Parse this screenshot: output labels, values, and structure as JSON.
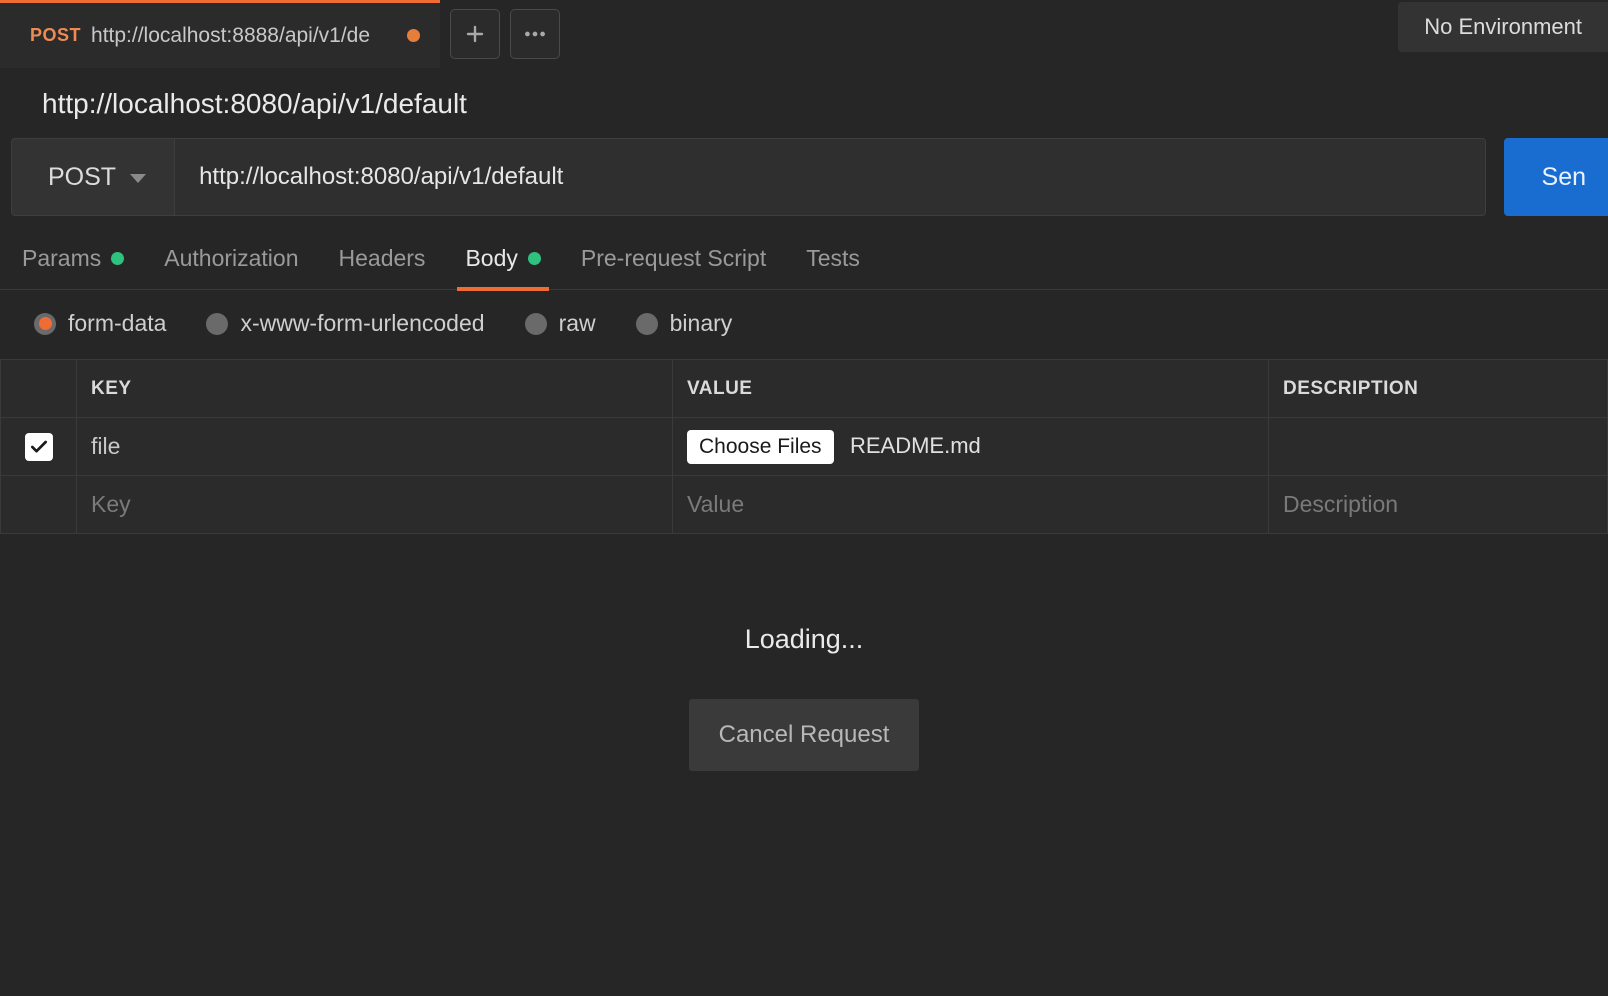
{
  "tab": {
    "method": "POST",
    "url": "http://localhost:8888/api/v1/de"
  },
  "environment": {
    "label": "No Environment"
  },
  "title": "http://localhost:8080/api/v1/default",
  "request": {
    "method": "POST",
    "url": "http://localhost:8080/api/v1/default",
    "send_label": "Sen"
  },
  "req_tabs": {
    "params": "Params",
    "authorization": "Authorization",
    "headers": "Headers",
    "body": "Body",
    "prerequest": "Pre-request Script",
    "tests": "Tests"
  },
  "body_types": {
    "formdata": "form-data",
    "urlencoded": "x-www-form-urlencoded",
    "raw": "raw",
    "binary": "binary"
  },
  "fd": {
    "headers": {
      "key": "KEY",
      "value": "VALUE",
      "description": "DESCRIPTION"
    },
    "rows": [
      {
        "key": "file",
        "choose_label": "Choose Files",
        "filename": "README.md"
      }
    ],
    "placeholders": {
      "key": "Key",
      "value": "Value",
      "description": "Description"
    }
  },
  "loading": {
    "text": "Loading...",
    "cancel": "Cancel Request"
  }
}
